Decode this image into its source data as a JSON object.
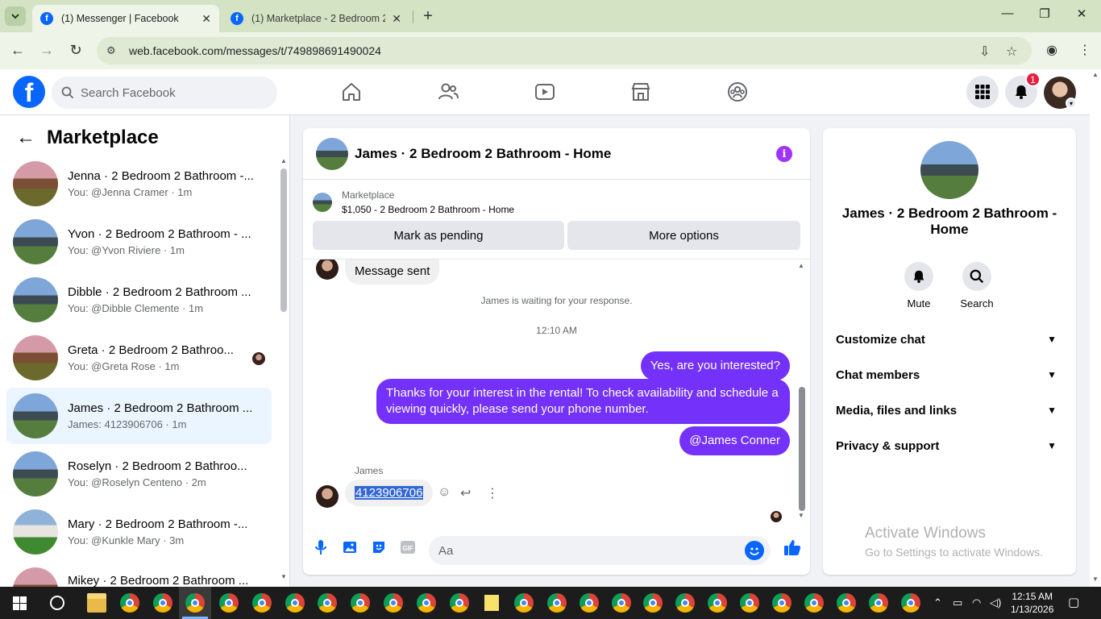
{
  "browser": {
    "tabs": [
      {
        "title": "(1) Messenger | Facebook",
        "active": true
      },
      {
        "title": "(1) Marketplace - 2 Bedroom 2",
        "active": false
      }
    ],
    "url": "web.facebook.com/messages/t/749898691490024"
  },
  "fb_header": {
    "search_placeholder": "Search Facebook",
    "notification_count": "1",
    "nav_icons": [
      "home-icon",
      "friends-icon",
      "video-icon",
      "marketplace-icon",
      "groups-icon"
    ]
  },
  "sidebar": {
    "title": "Marketplace",
    "conversations": [
      {
        "name": "Jenna · 2 Bedroom 2 Bathroom -...",
        "sub": "You: @Jenna Cramer · 1m",
        "active": false
      },
      {
        "name": "Yvon · 2 Bedroom 2 Bathroom - ...",
        "sub": "You: @Yvon Riviere · 1m",
        "active": false
      },
      {
        "name": "Dibble · 2 Bedroom 2 Bathroom ...",
        "sub": "You: @Dibble Clemente · 1m",
        "active": false
      },
      {
        "name": "Greta · 2 Bedroom 2 Bathroo...",
        "sub": "You: @Greta Rose · 1m",
        "active": false
      },
      {
        "name": "James · 2 Bedroom 2 Bathroom ...",
        "sub": "James: 4123906706 · 1m",
        "active": true
      },
      {
        "name": "Roselyn · 2 Bedroom 2 Bathroo...",
        "sub": "You: @Roselyn Centeno · 2m",
        "active": false
      },
      {
        "name": "Mary · 2 Bedroom 2 Bathroom -...",
        "sub": "You: @Kunkle Mary · 3m",
        "active": false
      },
      {
        "name": "Mikey · 2 Bedroom 2 Bathroom ...",
        "sub": "",
        "active": false
      }
    ]
  },
  "chat": {
    "title": "James · 2 Bedroom 2 Bathroom - Home",
    "listing_label": "Marketplace",
    "listing_value": "$1,050 - 2 Bedroom 2 Bathroom - Home",
    "mark_pending_label": "Mark as pending",
    "more_options_label": "More options",
    "message_sent_text": "Message sent",
    "waiting_text": "James is waiting for your response.",
    "timestamp": "12:10 AM",
    "outgoing": [
      "Yes, are you interested?",
      "Thanks for your interest in the rental! To check availability and schedule a viewing quickly, please send your phone number.",
      "@James Conner"
    ],
    "incoming_sender": "James",
    "incoming_text": "4123906706",
    "composer_placeholder": "Aa"
  },
  "right_panel": {
    "title": "James · 2 Bedroom 2 Bathroom - Home",
    "mute_label": "Mute",
    "search_label": "Search",
    "sections": [
      "Customize chat",
      "Chat members",
      "Media, files and links",
      "Privacy & support"
    ]
  },
  "watermark": {
    "line1": "Activate Windows",
    "line2": "Go to Settings to activate Windows."
  },
  "taskbar": {
    "time": "12:15 AM",
    "date": "1/13/2026"
  },
  "colors": {
    "fb_blue": "#0866ff",
    "messenger_purple": "#7431f9",
    "badge_red": "#e41e3f",
    "chrome_green": "#d3e3c3"
  }
}
